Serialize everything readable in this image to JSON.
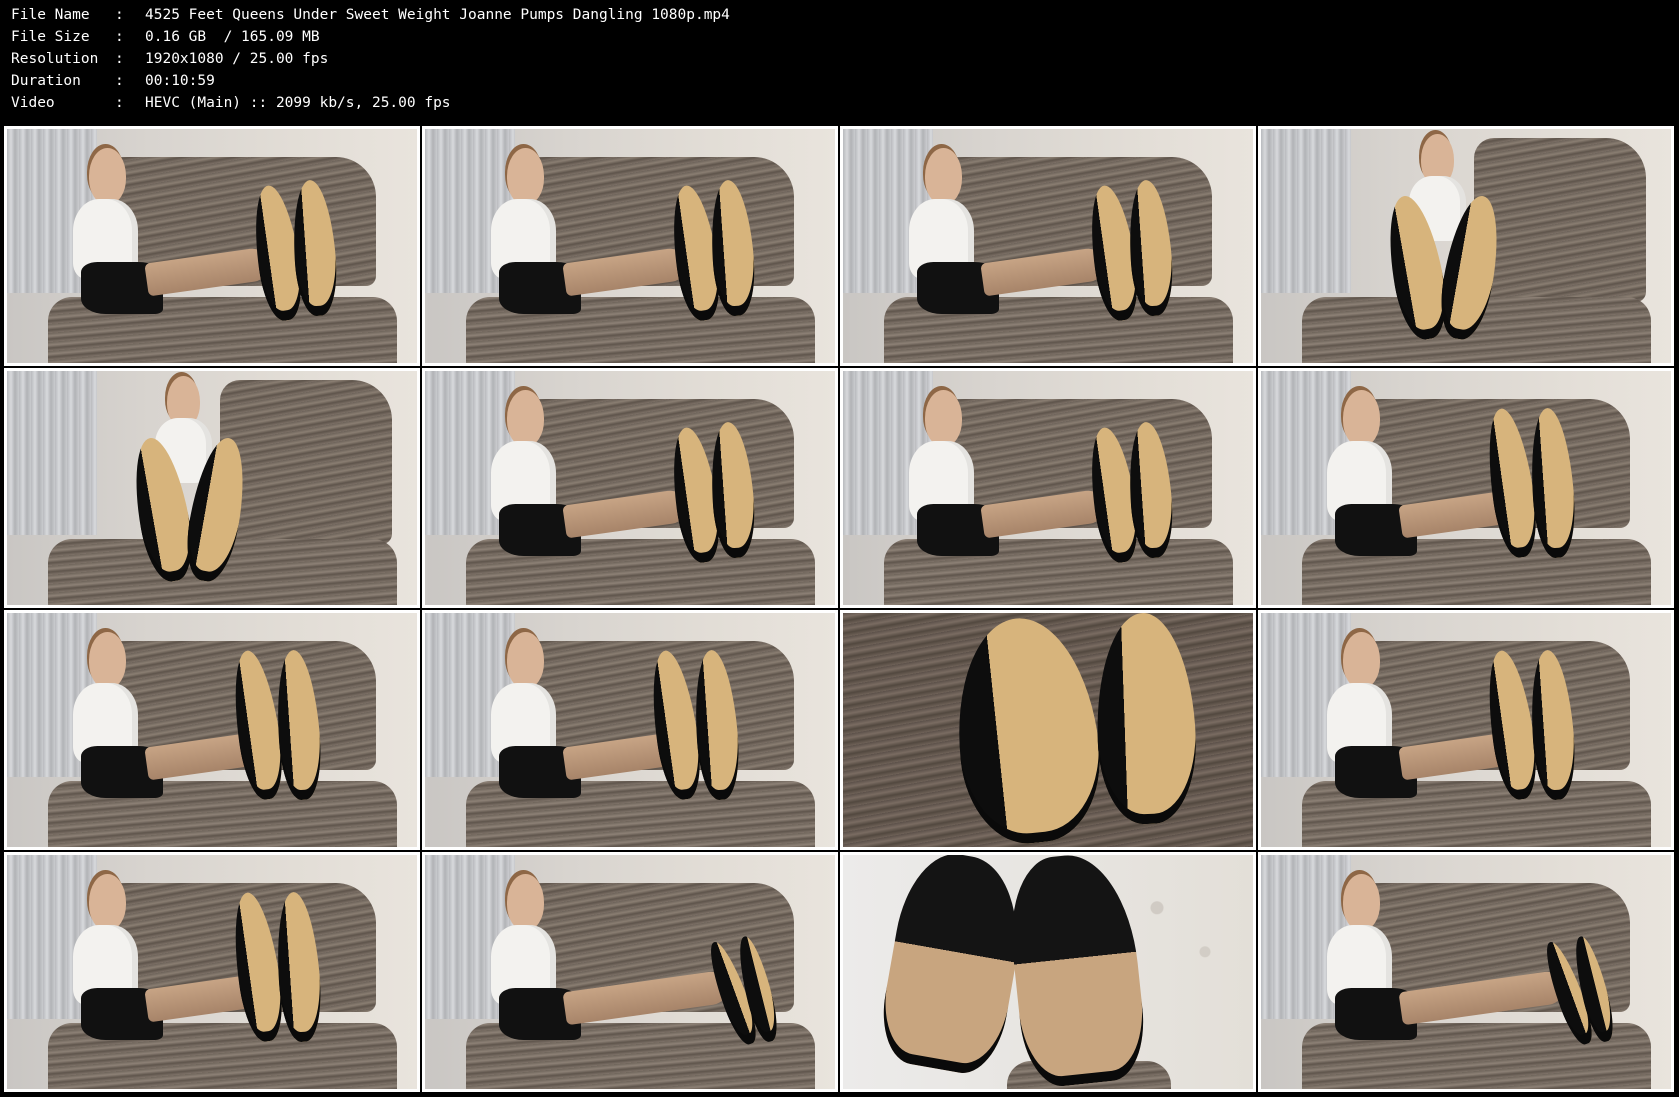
{
  "info": {
    "rows": [
      {
        "key": "File Name",
        "sep": ":",
        "value": "4525 Feet Queens Under Sweet Weight Joanne Pumps Dangling 1080p.mp4"
      },
      {
        "key": "File Size",
        "sep": ":",
        "value": "0.16 GB  / 165.09 MB"
      },
      {
        "key": "Resolution",
        "sep": ":",
        "value": "1920x1080 / 25.00 fps"
      },
      {
        "key": "Duration",
        "sep": ":",
        "value": "00:10:59"
      },
      {
        "key": "Video",
        "sep": ":",
        "value": "HEVC (Main) :: 2099 kb/s, 25.00 fps"
      }
    ]
  },
  "thumbnails": {
    "count": 16,
    "variants": [
      "sitting",
      "sitting",
      "sitting",
      "soles-center",
      "soles-center",
      "sitting",
      "sitting",
      "tall",
      "tall",
      "tall",
      "closeup",
      "tall",
      "tall",
      "dangling",
      "closeup-heels",
      "dangling"
    ]
  }
}
